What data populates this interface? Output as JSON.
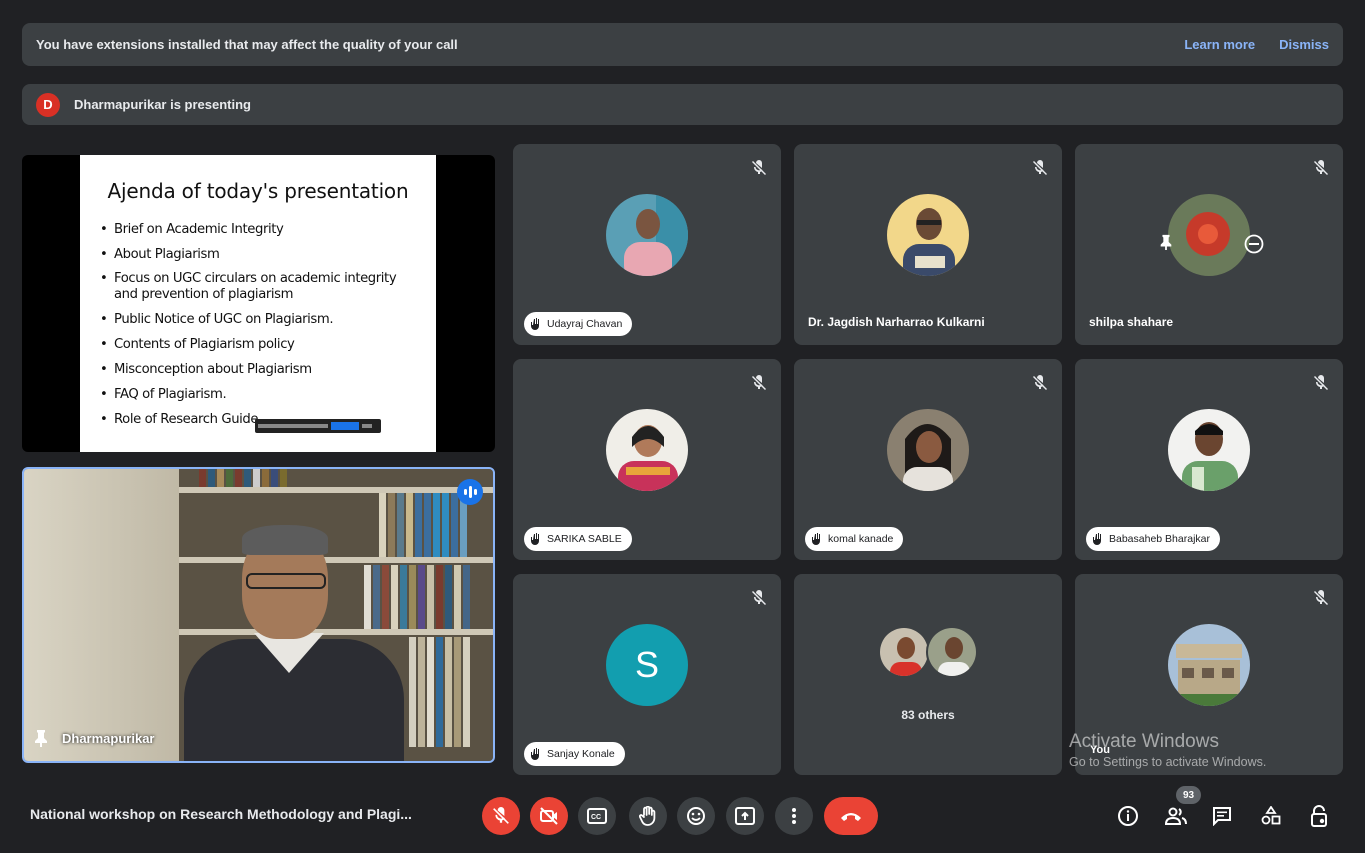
{
  "banner": {
    "extensions_msg": "You have extensions installed that may affect the quality of your call",
    "learn_more": "Learn more",
    "dismiss": "Dismiss"
  },
  "presenting": {
    "avatar_letter": "D",
    "text": "Dharmapurikar is presenting"
  },
  "slide": {
    "title": "Ajenda of today's presentation",
    "bullets": [
      "Brief on Academic Integrity",
      "About Plagiarism",
      "Focus on UGC circulars  on academic integrity and prevention of plagiarism",
      "Public Notice of UGC on Plagiarism.",
      "Contents of Plagiarism policy",
      "Misconception about Plagiarism",
      "FAQ of Plagiarism.",
      "Role of Research Guide."
    ]
  },
  "presenter": {
    "name": "Dharmapurikar"
  },
  "participants": [
    {
      "name": "Udayraj Chavan",
      "style": "pill",
      "muted": true
    },
    {
      "name": "Dr. Jagdish Narharrao Kulkarni",
      "style": "plain",
      "muted": true
    },
    {
      "name": "shilpa shahare",
      "style": "plain",
      "muted": true
    },
    {
      "name": "SARIKA SABLE",
      "style": "pill",
      "muted": true
    },
    {
      "name": "komal kanade",
      "style": "pill",
      "muted": true
    },
    {
      "name": "Babasaheb Bharajkar",
      "style": "pill",
      "muted": true
    },
    {
      "name": "Sanjay Konale",
      "style": "pill",
      "muted": true,
      "letter": "S"
    },
    {
      "name": "83 others",
      "style": "others",
      "muted": false
    },
    {
      "name": "You",
      "style": "plain",
      "muted": true
    }
  ],
  "watermark": {
    "line1": "Activate Windows",
    "line2": "Go to Settings to activate Windows."
  },
  "meeting": {
    "title": "National workshop on Research Methodology and Plagi..."
  },
  "toolbar": {
    "participant_count": "93",
    "icons": [
      "mic-off-icon",
      "camera-off-icon",
      "captions-icon",
      "raise-hand-icon",
      "emoji-icon",
      "present-icon",
      "more-options-icon",
      "end-call-icon"
    ],
    "right_icons": [
      "info-icon",
      "people-icon",
      "chat-icon",
      "activities-icon",
      "host-controls-icon"
    ]
  },
  "colors": {
    "background": "#202124",
    "tile": "#3c4043",
    "accent": "#8ab4f8",
    "danger": "#ea4335",
    "letter_avatar": "#129eaf"
  }
}
